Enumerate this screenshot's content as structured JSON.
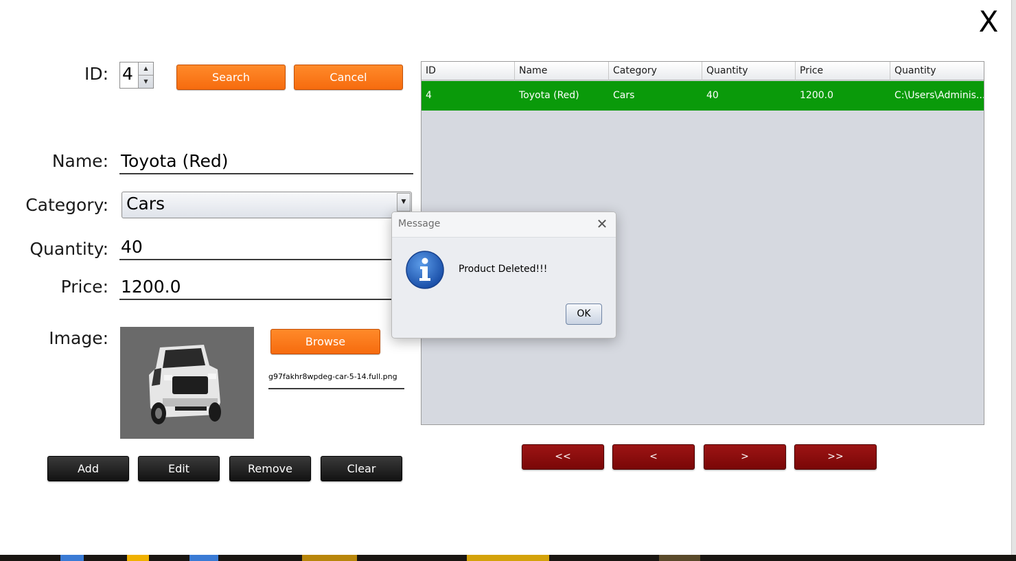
{
  "window": {
    "close_label": "X"
  },
  "form": {
    "id_label": "ID:",
    "id_value": "4",
    "search_label": "Search",
    "cancel_label": "Cancel",
    "name_label": "Name:",
    "name_value": "Toyota (Red)",
    "category_label": "Category:",
    "category_value": "Cars",
    "quantity_label": "Quantity:",
    "quantity_value": "40",
    "price_label": "Price:",
    "price_value": "1200.0",
    "image_label": "Image:",
    "browse_label": "Browse",
    "image_filename": "g97fakhr8wpdeg-car-5-14.full.png"
  },
  "actions": {
    "add": "Add",
    "edit": "Edit",
    "remove": "Remove",
    "clear": "Clear"
  },
  "table": {
    "columns": [
      "ID",
      "Name",
      "Category",
      "Quantity",
      "Price",
      "Quantity"
    ],
    "rows": [
      [
        "4",
        "Toyota (Red)",
        "Cars",
        "40",
        "1200.0",
        "C:\\Users\\Adminis..."
      ]
    ],
    "selected_row_color": "#0a9a0a"
  },
  "nav": {
    "first": "<<",
    "prev": "<",
    "next": ">",
    "last": ">>"
  },
  "dialog": {
    "title": "Message",
    "close_label": "✕",
    "message": "Product Deleted!!!",
    "ok_label": "OK",
    "icon": "info-icon"
  },
  "colors": {
    "orange_button": "#f66b0e",
    "dark_button": "#1e1e1e",
    "red_button": "#8b0a0a",
    "table_bg": "#d6d9e0"
  }
}
